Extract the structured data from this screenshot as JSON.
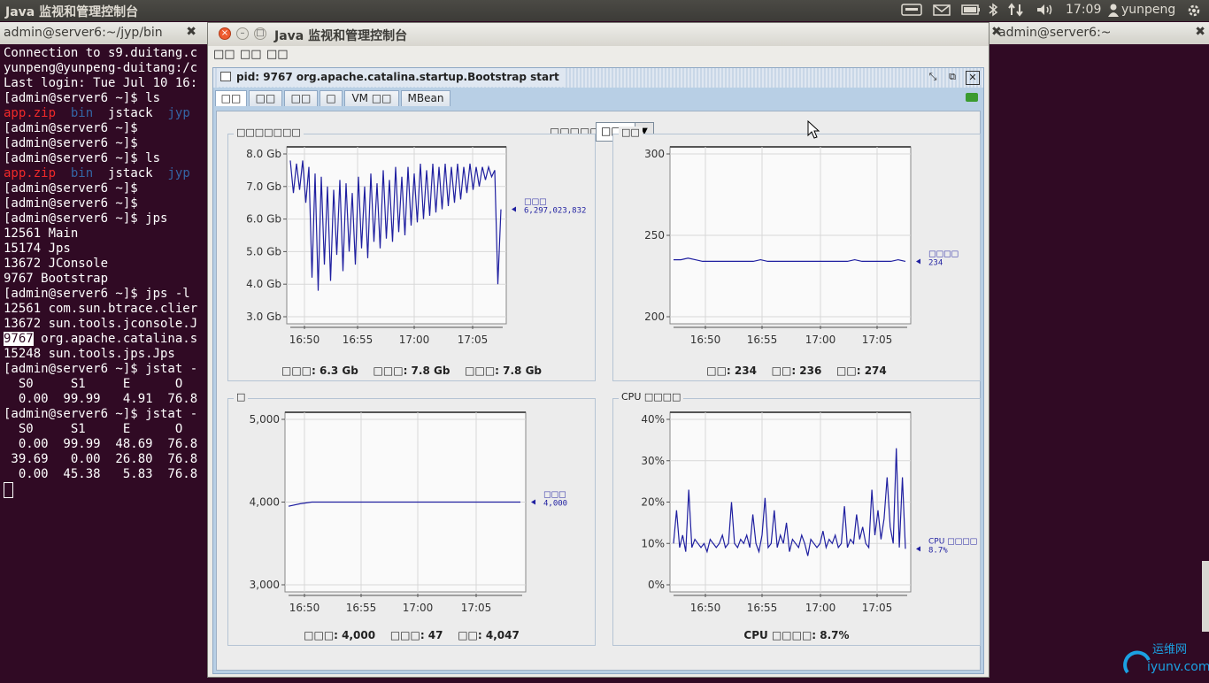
{
  "topbar": {
    "title": "Java 监视和管理控制台",
    "time": "17:09",
    "user": "yunpeng"
  },
  "terminal_left": {
    "tab": "admin@server6:~/jyp/bin",
    "lines": [
      "Connection to s9.duitang.c",
      "yunpeng@yunpeng-duitang:/c",
      "Last login: Tue Jul 10 16:",
      "[admin@server6 ~]$ ls",
      "app.zip  bin  jstack  jyp",
      "[admin@server6 ~]$",
      "[admin@server6 ~]$",
      "[admin@server6 ~]$ ls",
      "app.zip  bin  jstack  jyp",
      "[admin@server6 ~]$",
      "[admin@server6 ~]$",
      "[admin@server6 ~]$ jps",
      "12561 Main",
      "15174 Jps",
      "13672 JConsole",
      "9767 Bootstrap",
      "[admin@server6 ~]$ jps -l",
      "12561 com.sun.btrace.clier",
      "13672 sun.tools.jconsole.J",
      "9767 org.apache.catalina.s",
      "15248 sun.tools.jps.Jps",
      "[admin@server6 ~]$ jstat -",
      "  S0     S1     E      O",
      "  0.00  99.99   4.91  76.8",
      "[admin@server6 ~]$ jstat -",
      "  S0     S1     E      O",
      "  0.00  99.99  48.69  76.8",
      " 39.69   0.00  26.80  76.8",
      "  0.00  45.38   5.83  76.8"
    ]
  },
  "terminal_right": {
    "tab": "admin@server6:~"
  },
  "jconsole": {
    "title": "Java 监视和管理控制台",
    "menu": [
      "□□",
      "□□",
      "□□"
    ],
    "inner_title": "pid: 9767 org.apache.catalina.startup.Bootstrap start",
    "tabs": [
      "□□",
      "□□",
      "□□",
      "□",
      "VM □□",
      "MBean"
    ],
    "time_range_label": "□□□□□",
    "time_range_value": "□□",
    "charts": [
      {
        "title": "□□□□□□□",
        "legend_name": "□□□",
        "legend_value": "6,297,023,832",
        "footer": "□□□: 6.3 Gb    □□□: 7.8 Gb    □□□: 7.8 Gb"
      },
      {
        "title": "□□",
        "legend_name": "□□□□",
        "legend_value": "234",
        "footer": "□□: 234    □□: 236    □□: 274"
      },
      {
        "title": "□",
        "legend_name": "□□□",
        "legend_value": "4,000",
        "footer": "□□□: 4,000    □□□: 47    □□: 4,047"
      },
      {
        "title": "CPU □□□□",
        "legend_name": "CPU □□□□",
        "legend_value": "8.7%",
        "footer": "CPU □□□□: 8.7%"
      }
    ]
  },
  "chart_data": [
    {
      "type": "line",
      "xticks": [
        "16:50",
        "16:55",
        "17:00",
        "17:05"
      ],
      "yticks": [
        "8.0 Gb",
        "7.0 Gb",
        "6.0 Gb",
        "5.0 Gb",
        "4.0 Gb",
        "3.0 Gb"
      ],
      "ylim": [
        3.0,
        8.0
      ],
      "series": [
        {
          "name": "□□□",
          "values": [
            7.8,
            6.8,
            7.7,
            6.9,
            7.8,
            6.5,
            7.6,
            4.2,
            7.4,
            3.8,
            7.3,
            4.6,
            7.0,
            4.1,
            6.9,
            4.9,
            7.2,
            4.4,
            7.1,
            5.0,
            6.8,
            4.6,
            7.3,
            5.1,
            7.0,
            4.8,
            7.4,
            5.3,
            7.1,
            5.1,
            7.5,
            5.4,
            7.2,
            5.3,
            7.6,
            5.6,
            7.3,
            5.5,
            7.6,
            5.8,
            7.4,
            5.9,
            7.7,
            6.0,
            7.5,
            6.1,
            7.7,
            6.2,
            7.6,
            6.3,
            7.7,
            6.4,
            7.6,
            6.5,
            7.7,
            6.6,
            7.6,
            6.8,
            7.7,
            6.9,
            7.6,
            7.0,
            7.6,
            7.2,
            7.6,
            7.3,
            7.5,
            4.0,
            6.3
          ]
        }
      ]
    },
    {
      "type": "line",
      "xticks": [
        "16:50",
        "16:55",
        "17:00",
        "17:05"
      ],
      "yticks": [
        "300",
        "250",
        "200"
      ],
      "ylim": [
        200,
        300
      ],
      "series": [
        {
          "name": "□□□□",
          "values": [
            235,
            235,
            236,
            235,
            234,
            234,
            234,
            234,
            234,
            234,
            234,
            234,
            235,
            234,
            234,
            234,
            234,
            234,
            234,
            234,
            234,
            234,
            234,
            234,
            234,
            235,
            234,
            234,
            234,
            234,
            234,
            235,
            234
          ]
        }
      ]
    },
    {
      "type": "line",
      "xticks": [
        "16:50",
        "16:55",
        "17:00",
        "17:05"
      ],
      "yticks": [
        "5,000",
        "4,000",
        "3,000"
      ],
      "ylim": [
        3000,
        5000
      ],
      "series": [
        {
          "name": "□□□",
          "values": [
            3950,
            3980,
            4000,
            4000,
            4000,
            4000,
            4000,
            4000,
            4000,
            4000,
            4000,
            4000,
            4000,
            4000,
            4000,
            4000,
            4000,
            4000,
            4000,
            4000,
            4000
          ]
        }
      ]
    },
    {
      "type": "line",
      "xticks": [
        "16:50",
        "16:55",
        "17:00",
        "17:05"
      ],
      "yticks": [
        "40%",
        "30%",
        "20%",
        "10%",
        "0%"
      ],
      "ylim": [
        0,
        40
      ],
      "series": [
        {
          "name": "CPU □□□□",
          "values": [
            10,
            18,
            9,
            12,
            8,
            23,
            9,
            11,
            10,
            9,
            10,
            8,
            11,
            10,
            9,
            10,
            12,
            9,
            10,
            20,
            10,
            9,
            11,
            10,
            12,
            9,
            17,
            10,
            8,
            12,
            21,
            9,
            10,
            18,
            9,
            12,
            10,
            15,
            8,
            11,
            10,
            9,
            12,
            10,
            7,
            11,
            10,
            9,
            10,
            13,
            9,
            11,
            10,
            12,
            9,
            10,
            19,
            9,
            11,
            10,
            17,
            11,
            14,
            10,
            9,
            23,
            12,
            18,
            11,
            16,
            26,
            14,
            10,
            33,
            9,
            26,
            8.7
          ]
        }
      ]
    }
  ]
}
